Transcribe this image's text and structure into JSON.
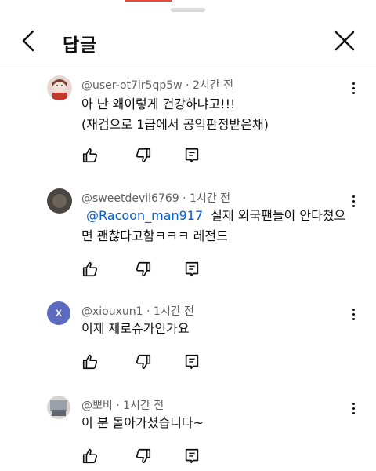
{
  "header": {
    "title": "답글"
  },
  "comments": [
    {
      "author": "@user-ot7ir5qp5w",
      "separator": "·",
      "time": "2시간 전",
      "lines": [
        "아 난 왜이렇게 건강하냐고!!!",
        "(재검으로 1급에서 공익판정받은채)"
      ]
    },
    {
      "author": "@sweetdevil6769",
      "separator": "·",
      "time": "1시간 전",
      "mention": "@Racoon_man917",
      "line1_rest": "실제 외국팬들이 안다쳤으",
      "line2": "면 괜찮다고함ㅋㅋㅋ 레전드"
    },
    {
      "author": "@xiouxun1",
      "separator": "·",
      "time": "1시간 전",
      "avatar_letter": "X",
      "lines": [
        "이제 제로슈가인가요"
      ]
    },
    {
      "author": "@뽀비",
      "separator": "·",
      "time": "1시간 전",
      "lines": [
        "이 분 돌아가셨습니다~"
      ]
    }
  ],
  "colors": {
    "mention": "#065fd4",
    "meta": "#606060",
    "avatar_x": "#5c6bc0"
  },
  "icons": {
    "back": "chevron-left-icon",
    "close": "close-icon",
    "more": "more-vert-icon",
    "like": "thumb-up-icon",
    "dislike": "thumb-down-icon",
    "reply": "reply-icon"
  }
}
